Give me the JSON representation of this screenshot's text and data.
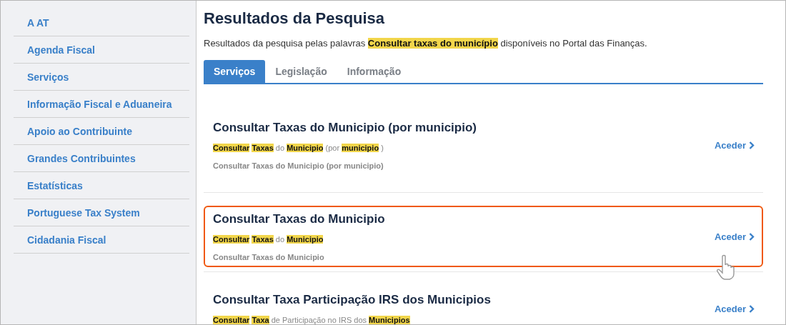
{
  "sidebar": {
    "items": [
      {
        "label": "A AT"
      },
      {
        "label": "Agenda Fiscal"
      },
      {
        "label": "Serviços"
      },
      {
        "label": "Informação Fiscal e Aduaneira"
      },
      {
        "label": "Apoio ao Contribuinte"
      },
      {
        "label": "Grandes Contribuintes"
      },
      {
        "label": "Estatísticas"
      },
      {
        "label": "Portuguese Tax System"
      },
      {
        "label": "Cidadania Fiscal"
      }
    ]
  },
  "page_title": "Resultados da Pesquisa",
  "intro": "Resultados da pesquisa pelas palavras **Consultar taxas do município** disponíveis no Portal das Finanças.",
  "tabs": [
    {
      "label": "Serviços",
      "selected": true
    },
    {
      "label": "Legislação",
      "selected": false
    },
    {
      "label": "Informação",
      "selected": false
    }
  ],
  "results": [
    {
      "title": "Consultar Taxas do Municipio (por municipio)",
      "snippet": "**Consultar** **Taxas** do **Municipio** (por **municipio** )",
      "description": "Consultar Taxas do Municipio (por municipio)",
      "link": "Aceder",
      "outlined": false,
      "pointer": false
    },
    {
      "title": "Consultar Taxas do Municipio",
      "snippet": "**Consultar** **Taxas** do **Municipio**",
      "description": "Consultar Taxas do Municipio",
      "link": "Aceder",
      "outlined": true,
      "pointer": true
    },
    {
      "title": "Consultar Taxa Participação IRS dos Municipios",
      "snippet": "**Consultar** **Taxa** de Participação no IRS dos **Municipios**",
      "link": "Aceder",
      "outlined": false,
      "pointer": false
    }
  ]
}
